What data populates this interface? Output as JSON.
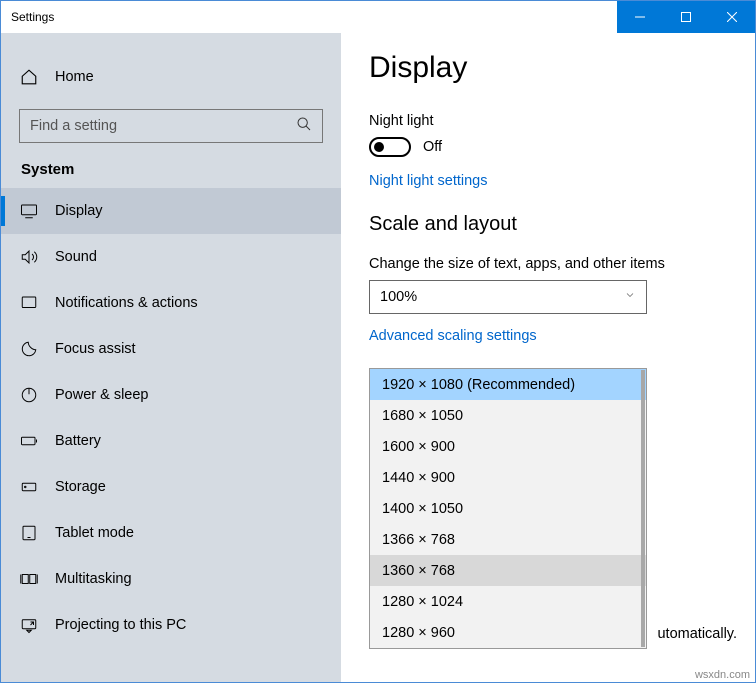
{
  "window_title": "Settings",
  "home_label": "Home",
  "search_placeholder": "Find a setting",
  "section_title": "System",
  "nav": [
    {
      "label": "Display",
      "icon": "display",
      "selected": true
    },
    {
      "label": "Sound",
      "icon": "sound"
    },
    {
      "label": "Notifications & actions",
      "icon": "notifications"
    },
    {
      "label": "Focus assist",
      "icon": "focus"
    },
    {
      "label": "Power & sleep",
      "icon": "power"
    },
    {
      "label": "Battery",
      "icon": "battery"
    },
    {
      "label": "Storage",
      "icon": "storage"
    },
    {
      "label": "Tablet mode",
      "icon": "tablet"
    },
    {
      "label": "Multitasking",
      "icon": "multitasking"
    },
    {
      "label": "Projecting to this PC",
      "icon": "projecting"
    }
  ],
  "page_heading": "Display",
  "night_light_label": "Night light",
  "night_light_state": "Off",
  "night_light_link": "Night light settings",
  "scale_heading": "Scale and layout",
  "scale_caption": "Change the size of text, apps, and other items",
  "scale_value": "100%",
  "advanced_scaling_link": "Advanced scaling settings",
  "resolutions": [
    {
      "label": "1920 × 1080 (Recommended)",
      "recommended": true
    },
    {
      "label": "1680 × 1050"
    },
    {
      "label": "1600 × 900"
    },
    {
      "label": "1440 × 900"
    },
    {
      "label": "1400 × 1050"
    },
    {
      "label": "1366 × 768"
    },
    {
      "label": "1360 × 768",
      "hovered": true
    },
    {
      "label": "1280 × 1024"
    },
    {
      "label": "1280 × 960"
    }
  ],
  "bottom_text_fragment": "utomatically.",
  "attribution": "wsxdn.com"
}
